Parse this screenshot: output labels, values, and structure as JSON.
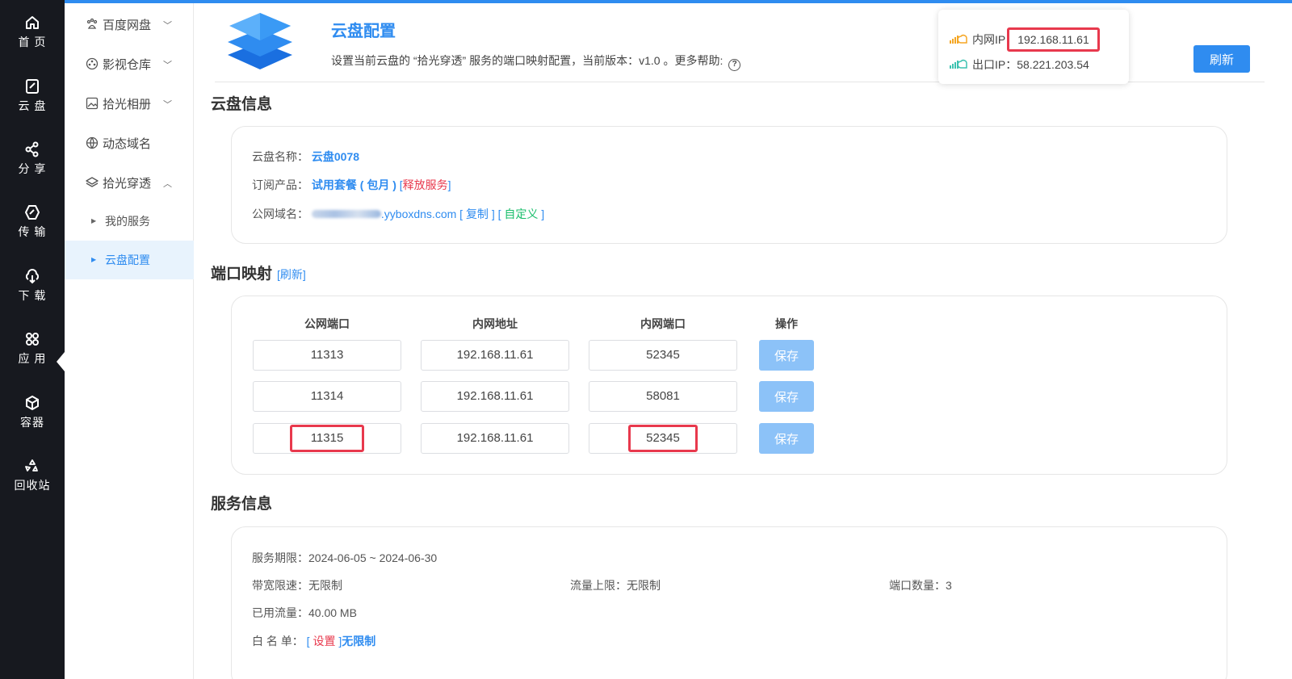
{
  "rail": {
    "items": [
      {
        "label": "首 页",
        "icon": "home-icon"
      },
      {
        "label": "云 盘",
        "icon": "disk-icon"
      },
      {
        "label": "分 享",
        "icon": "share-icon"
      },
      {
        "label": "传 输",
        "icon": "transfer-icon"
      },
      {
        "label": "下 载",
        "icon": "cloud-download-icon"
      },
      {
        "label": "应 用",
        "icon": "apps-icon"
      },
      {
        "label": "容器",
        "icon": "container-icon"
      },
      {
        "label": "回收站",
        "icon": "recycle-icon"
      }
    ],
    "active_index": 5
  },
  "submenu": {
    "items": [
      {
        "label": "百度网盘",
        "icon": "paw-icon"
      },
      {
        "label": "影视仓库",
        "icon": "film-reel-icon"
      },
      {
        "label": "拾光相册",
        "icon": "image-icon"
      },
      {
        "label": "动态域名",
        "icon": "globe-icon"
      },
      {
        "label": "拾光穿透",
        "icon": "layers-icon"
      }
    ],
    "children": [
      {
        "label": "我的服务"
      },
      {
        "label": "云盘配置",
        "active": true
      }
    ]
  },
  "header": {
    "title": "云盘配置",
    "description": "设置当前云盘的 “拾光穿透” 服务的端口映射配置，当前版本：v1.0 。更多帮助:",
    "help_glyph": "?",
    "refresh_label": "刷新"
  },
  "ip_info": {
    "lan_label": "内网IP",
    "lan_value": "192.168.11.61",
    "wan_label": "出口IP：",
    "wan_value": "58.221.203.54"
  },
  "cloud_info": {
    "section_title": "云盘信息",
    "name_label": "云盘名称：",
    "name_value": "云盘0078",
    "product_label": "订阅产品：",
    "product_value": "试用套餐 ( 包月 )",
    "release_label": "释放服务",
    "domain_label": "公网域名：",
    "domain_value": ".yyboxdns.com",
    "copy_label": "复制",
    "custom_label": "自定义",
    "bracket_open": "[",
    "bracket_close": "]"
  },
  "port_mapping": {
    "section_title": "端口映射",
    "refresh_link": "[刷新]",
    "columns": [
      "公网端口",
      "内网地址",
      "内网端口",
      "操作"
    ],
    "rows": [
      {
        "public_port": "11313",
        "lan_addr": "192.168.11.61",
        "lan_port": "52345",
        "action": "保存"
      },
      {
        "public_port": "11314",
        "lan_addr": "192.168.11.61",
        "lan_port": "58081",
        "action": "保存"
      },
      {
        "public_port": "11315",
        "lan_addr": "192.168.11.61",
        "lan_port": "52345",
        "action": "保存"
      }
    ]
  },
  "service_info": {
    "section_title": "服务信息",
    "period_label": "服务期限：",
    "period_value": "2024-06-05 ~ 2024-06-30",
    "bandwidth_label": "带宽限速：",
    "bandwidth_value": "无限制",
    "traffic_limit_label": "流量上限：",
    "traffic_limit_value": "无限制",
    "port_count_label": "端口数量：",
    "port_count_value": "3",
    "used_traffic_label": "已用流量：",
    "used_traffic_value": "40.00 MB",
    "whitelist_label": "白 名 单：",
    "whitelist_set": "设置",
    "whitelist_value": "无限制"
  },
  "colors": {
    "accent": "#2f8cf0",
    "rail_bg": "#17191f",
    "highlight": "#e8394d",
    "save_btn": "#8cc2f8",
    "success": "#19be6b"
  }
}
